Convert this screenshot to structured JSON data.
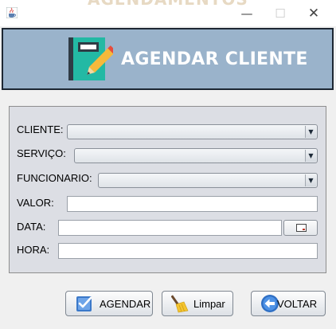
{
  "window": {
    "bg_title": "AGENDAMENTOS",
    "controls": {
      "minimize": "—",
      "maximize": "☐",
      "close": "✕"
    }
  },
  "banner": {
    "title": "AGENDAR CLIENTE"
  },
  "form": {
    "cliente": {
      "label": "CLIENTE:",
      "value": ""
    },
    "servico": {
      "label": "SERVIÇO:",
      "value": ""
    },
    "funcionario": {
      "label": "FUNCIONARIO:",
      "value": ""
    },
    "valor": {
      "label": "VALOR:",
      "value": ""
    },
    "data": {
      "label": "DATA:",
      "value": ""
    },
    "hora": {
      "label": "HORA:",
      "value": ""
    }
  },
  "buttons": {
    "agendar": "AGENDAR",
    "limpar": "Limpar",
    "voltar": "VOLTAR"
  },
  "colors": {
    "banner_bg": "#9ab3cb",
    "panel_bg": "#dcdee4",
    "window_bg": "#f0f0f0"
  },
  "icons": {
    "app": "java-cup-icon",
    "banner": "notebook-pencil-icon",
    "agendar": "checkbox-icon",
    "limpar": "broom-icon",
    "voltar": "back-arrow-icon",
    "date_picker": "calendar-icon"
  }
}
